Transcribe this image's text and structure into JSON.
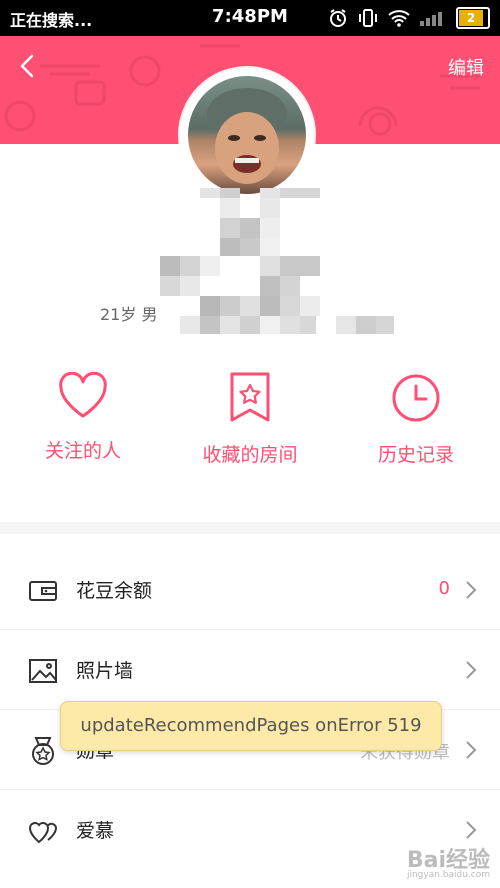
{
  "status_bar": {
    "left_text": "正在搜索...",
    "time": "7:48PM",
    "battery": "2"
  },
  "header": {
    "edit_label": "编辑",
    "bg_color": "#ff4f72"
  },
  "profile": {
    "age_gender": "21岁 男"
  },
  "quick_links": [
    {
      "label": "关注的人",
      "icon": "heart-icon"
    },
    {
      "label": "收藏的房间",
      "icon": "bookmark-star-icon"
    },
    {
      "label": "历史记录",
      "icon": "clock-icon"
    }
  ],
  "menu": [
    {
      "label": "花豆余额",
      "value": "0",
      "icon": "wallet-icon"
    },
    {
      "label": "照片墙",
      "value": "",
      "icon": "image-icon"
    },
    {
      "label": "勋章",
      "value": "未获得勋章",
      "icon": "medal-icon"
    },
    {
      "label": "爱慕",
      "value": "",
      "icon": "double-heart-icon"
    }
  ],
  "toast": {
    "text": "updateRecommendPages onError 519"
  },
  "watermark": {
    "text": "Bai经验",
    "sub": "jingyan.baidu.com"
  },
  "colors": {
    "accent": "#ff4f72",
    "toast_bg": "#fde9a8"
  }
}
